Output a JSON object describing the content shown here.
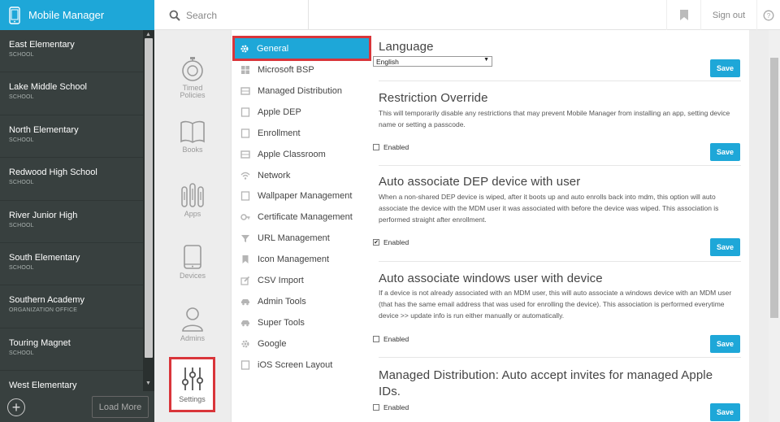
{
  "app": {
    "title": "Mobile Manager"
  },
  "search": {
    "placeholder": "Search"
  },
  "header": {
    "signout": "Sign out"
  },
  "schools": [
    {
      "name": "East Elementary",
      "type": "SCHOOL"
    },
    {
      "name": "Lake Middle School",
      "type": "SCHOOL"
    },
    {
      "name": "North Elementary",
      "type": "SCHOOL"
    },
    {
      "name": "Redwood High School",
      "type": "SCHOOL"
    },
    {
      "name": "River Junior High",
      "type": "SCHOOL"
    },
    {
      "name": "South Elementary",
      "type": "SCHOOL"
    },
    {
      "name": "Southern Academy",
      "type": "ORGANIZATION OFFICE"
    },
    {
      "name": "Touring Magnet",
      "type": "SCHOOL"
    },
    {
      "name": "West Elementary",
      "type": ""
    }
  ],
  "sidebar_footer": {
    "load_more": "Load More"
  },
  "iconnav": {
    "timed": "Timed Policies",
    "books": "Books",
    "apps": "Apps",
    "devices": "Devices",
    "admins": "Admins",
    "settings": "Settings"
  },
  "menu": [
    "General",
    "Microsoft BSP",
    "Managed Distribution",
    "Apple DEP",
    "Enrollment",
    "Apple Classroom",
    "Network",
    "Wallpaper Management",
    "Certificate Management",
    "URL Management",
    "Icon Management",
    "CSV Import",
    "Admin Tools",
    "Super Tools",
    "Google",
    "iOS Screen Layout"
  ],
  "sections": {
    "language": {
      "title": "Language",
      "selected": "English",
      "save": "Save"
    },
    "restriction": {
      "title": "Restriction Override",
      "desc": "This will temporarily disable any restrictions that may prevent Mobile Manager from installing an app, setting device name or setting a passcode.",
      "checkbox": "Enabled",
      "checked": false,
      "save": "Save"
    },
    "dep": {
      "title": "Auto associate DEP device with user",
      "desc": "When a non-shared DEP device is wiped, after it boots up and auto enrolls back into mdm, this option will auto associate the device with the MDM user it was associated with before the device was wiped. This association is performed straight after enrollment.",
      "checkbox": "Enabled",
      "checked": true,
      "save": "Save"
    },
    "windows": {
      "title": "Auto associate windows user with device",
      "desc": "If a device is not already associated with an MDM user, this will auto associate a windows device with an MDM user (that has the same email address that was used for enrolling the device). This association is performed everytime device >> update info is run either manually or automatically.",
      "checkbox": "Enabled",
      "checked": false,
      "save": "Save"
    },
    "managed": {
      "title": "Managed Distribution: Auto accept invites for managed Apple IDs.",
      "checkbox": "Enabled",
      "checked": false,
      "save": "Save"
    }
  },
  "colors": {
    "accent": "#1ea7d8",
    "highlight": "#d9353a",
    "sidebar": "#38403f"
  }
}
